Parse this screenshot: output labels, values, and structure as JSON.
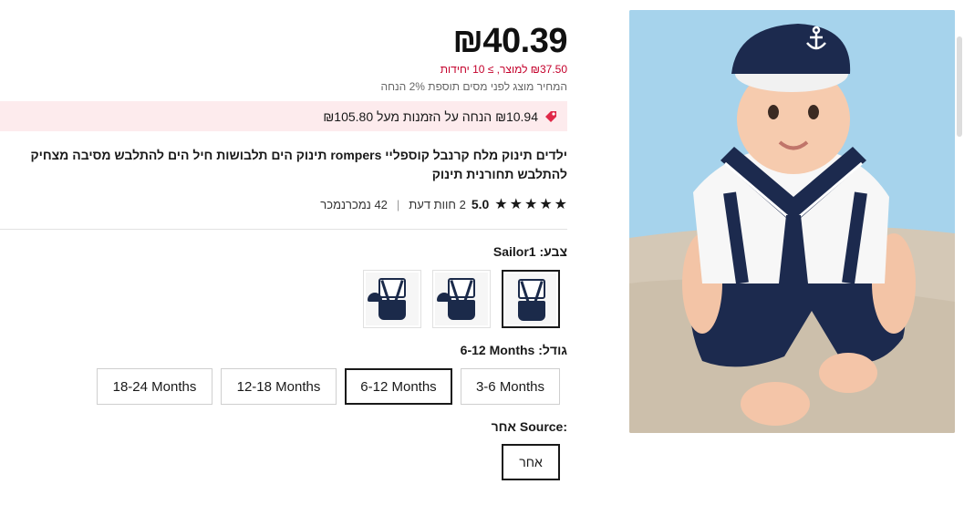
{
  "product": {
    "price": "₪40.39",
    "unit_price": "₪37.50 למוצר, ≥ 10 יחידות",
    "tax_note": "המחיר מוצג לפני מסים תוספת 2% הנחה",
    "discount_text": "₪10.94 הנחה על הזמנות מעל ₪105.80",
    "title": "ילדים תינוק מלח קרנבל קוספליי rompers תינוק הים תלבושות חיל הים להתלבש מסיבה מצחיק להתלבש תחורנית תינוק",
    "rating": {
      "score": "5.0",
      "reviews": "2 חוות דעת",
      "sold": "42 נמכרנמכר",
      "stars": [
        "★",
        "★",
        "★",
        "★",
        "★"
      ]
    }
  },
  "color": {
    "label": "צבע:",
    "value": "Sailor1",
    "swatches": [
      "Sailor1",
      "Sailor2",
      "Sailor3"
    ]
  },
  "size": {
    "label": "גודל:",
    "value": "6-12 Months",
    "options": [
      "3-6 Months",
      "6-12 Months",
      "12-18 Months",
      "18-24 Months"
    ]
  },
  "source": {
    "label": "Source:",
    "value": "אחר",
    "options": [
      "אחר"
    ]
  },
  "colors": {
    "accent_red": "#c4002b",
    "discount_bg": "#fdebed",
    "navy": "#1b2a4a"
  },
  "icons": {
    "discount": "tag-icon",
    "star": "star-icon"
  }
}
